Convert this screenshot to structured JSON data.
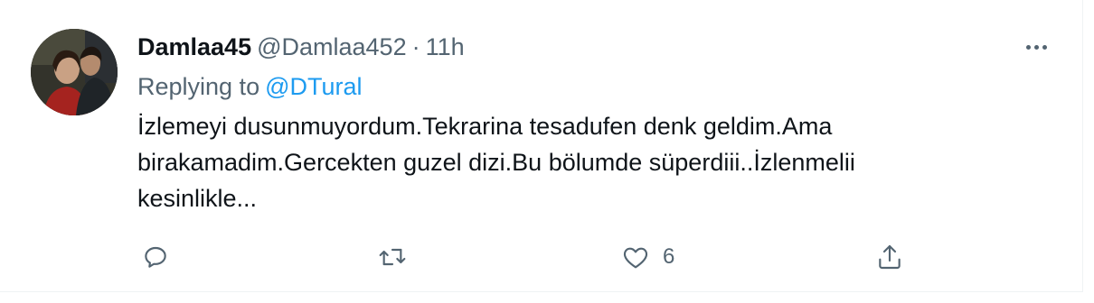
{
  "tweet": {
    "display_name": "Damlaa45",
    "handle": "@Damlaa452",
    "separator": "·",
    "time": "11h",
    "replying_prefix": "Replying to",
    "replying_to": "@DTural",
    "text": "İzlemeyi dusunmuyordum.Tekrarina tesadufen denk geldim.Ama birakamadim.Gercekten guzel dizi.Bu bölumde süperdiii..İzlenmelii kesinlikle...",
    "actions": {
      "reply_icon": "reply-icon",
      "retweet_icon": "retweet-icon",
      "like_icon": "heart-icon",
      "like_count": "6",
      "share_icon": "share-icon"
    }
  },
  "colors": {
    "text_primary": "#0f1419",
    "text_secondary": "#536471",
    "link": "#1d9bf0",
    "border": "#eff3f4"
  }
}
